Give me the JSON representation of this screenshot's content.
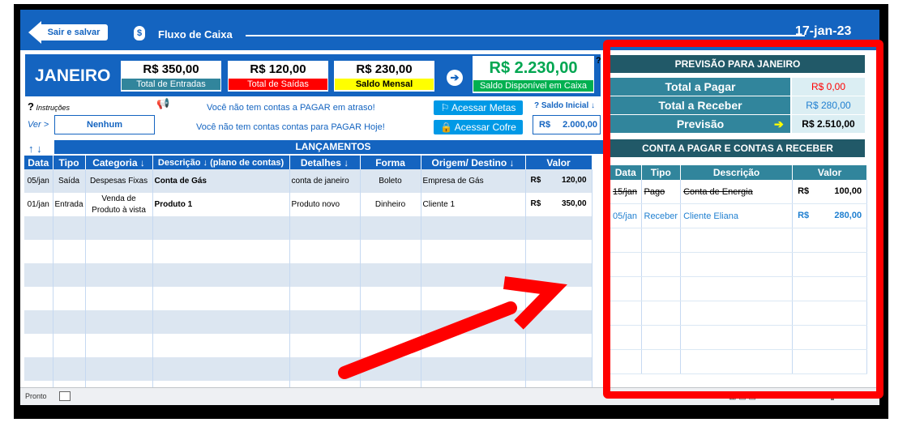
{
  "header": {
    "back_label": "Sair e salvar",
    "title": "Fluxo de Caixa",
    "date": "17-jan-23"
  },
  "summary": {
    "month": "JANEIRO",
    "total_entradas": {
      "value": "R$ 350,00",
      "label": "Total de Entradas"
    },
    "total_saidas": {
      "value": "R$ 120,00",
      "label": "Total de Saídas"
    },
    "saldo_mensal": {
      "value": "R$ 230,00",
      "label": "Saldo Mensal"
    },
    "saldo_disponivel": {
      "value": "R$ 2.230,00",
      "label": "Saldo Disponível em Caixa"
    },
    "help": "?"
  },
  "info": {
    "instructions_q": "?",
    "instructions": "Instruções",
    "ver_label": "Ver >",
    "ver_value": "Nenhum",
    "notice1": "Você não tem contas a PAGAR em atraso!",
    "notice2": "Você não tem contas contas para PAGAR Hoje!",
    "btn_metas": "⚐ Acessar Metas",
    "btn_cofre": "🔒 Acessar Cofre",
    "saldo_inicial_label": "? Saldo Inicial ↓",
    "saldo_inicial_currency": "R$",
    "saldo_inicial_value": "2.000,00"
  },
  "lancamentos": {
    "title": "LANÇAMENTOS",
    "sort_arrows": "↑ ↓",
    "columns": [
      "Data",
      "Tipo",
      "Categoria ↓",
      "Descrição ↓ (plano de contas)",
      "Detalhes ↓",
      "Forma",
      "Origem/ Destino ↓",
      "Valor"
    ],
    "rows": [
      {
        "data": "05/jan",
        "tipo": "Saída",
        "categoria": "Despesas Fixas",
        "descricao": "Conta de Gás",
        "detalhes": "conta de janeiro",
        "forma": "Boleto",
        "origem": "Empresa de Gás",
        "cur": "R$",
        "valor": "120,00"
      },
      {
        "data": "01/jan",
        "tipo": "Entrada",
        "categoria": "Venda de Produto à vista",
        "descricao": "Produto 1",
        "detalhes": "Produto novo",
        "forma": "Dinheiro",
        "origem": "Cliente 1",
        "cur": "R$",
        "valor": "350,00"
      }
    ]
  },
  "previsao": {
    "title": "PREVISÃO PARA JANEIRO",
    "total_pagar_label": "Total a Pagar",
    "total_pagar_value": "R$ 0,00",
    "total_receber_label": "Total a Receber",
    "total_receber_value": "R$ 280,00",
    "previsao_label": "Previsão",
    "previsao_value": "R$ 2.510,00"
  },
  "contas": {
    "title": "CONTA A PAGAR E CONTAS A RECEBER",
    "columns": [
      "Data",
      "Tipo",
      "Descrição",
      "Valor"
    ],
    "rows": [
      {
        "data": "15/jan",
        "tipo": "Pago",
        "descricao": "Conta de Energia",
        "cur": "R$",
        "valor": "100,00"
      },
      {
        "data": "05/jan",
        "tipo": "Receber",
        "descricao": "Cliente Eliana",
        "cur": "R$",
        "valor": "280,00"
      }
    ]
  },
  "statusbar": {
    "status": "Pronto",
    "zoom": "100%"
  },
  "colors": {
    "brand_blue": "#1464c0",
    "teal": "#31859c",
    "dark_teal": "#215968",
    "annotation_red": "#ff0000"
  }
}
